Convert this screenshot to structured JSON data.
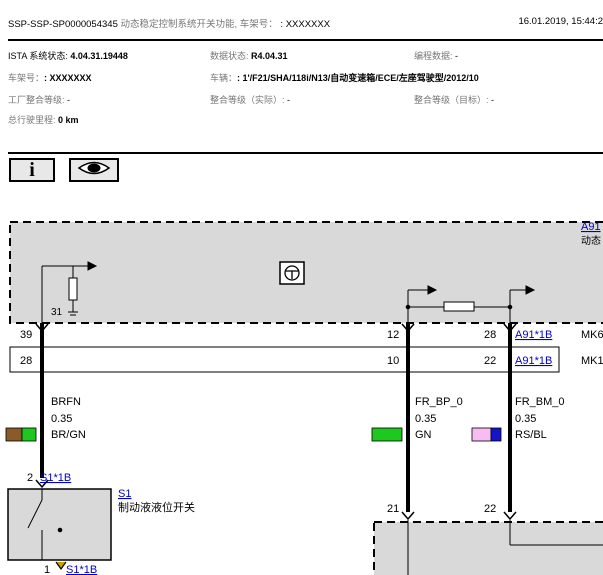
{
  "header": {
    "doc_id": "SSP-SSP-SP0000054345",
    "title": "动态稳定控制系统开关功能, 车架号：",
    "vin_value": ": XXXXXXX",
    "datetime": "16.01.2019, 15:44:2"
  },
  "info": {
    "ista_label": "ISTA 系统状态: ",
    "ista_value": "4.04.31.19448",
    "data_label": "数据状态: ",
    "data_value": "R4.04.31",
    "prog_label": "编程数据: ",
    "prog_value": "-",
    "chassis_label": "车架号：",
    "chassis_value": ": XXXXXXX",
    "vehicle_label": "车辆：",
    "vehicle_value": ": 1'/F21/SHA/118i/N13/自动变速箱/ECE/左座驾驶型/2012/10",
    "factory_label": "工厂整合等级: ",
    "factory_value": "-",
    "actual_label": "整合等级（实际）: ",
    "actual_value": "-",
    "target_label": "整合等级（目标）: ",
    "target_value": "-",
    "mileage_label": "总行驶里程: ",
    "mileage_value": "0 km"
  },
  "toolbar": {
    "info_glyph": "i"
  },
  "diagram": {
    "module_ref": "A91",
    "module_desc": "动态",
    "pin31": "31",
    "pin39": "39",
    "pin12": "12",
    "pin28_top": "28",
    "link_a91_1": "A91*1B",
    "mk_1": "MK6",
    "pin28_left": "28",
    "pin10": "10",
    "pin22": "22",
    "link_a91_2": "A91*1B",
    "mk_2": "MK1",
    "wire1_name": "BRFN",
    "wire1_size": "0.35",
    "wire1_color": "BR/GN",
    "wire2_name": "FR_BP_0",
    "wire2_size": "0.35",
    "wire2_color": "GN",
    "wire3_name": "FR_BM_0",
    "wire3_size": "0.35",
    "wire3_color": "RS/BL",
    "s1_pin2": "2",
    "s1_conn_top": "S1*1B",
    "s1_ref": "S1",
    "s1_desc": "制动液液位开关",
    "s1_pin1": "1",
    "s1_conn_bottom": "S1*1B",
    "pin21": "21",
    "pin22_bottom": "22"
  },
  "colors": {
    "brown": "#8b5a2b",
    "green": "#1ec81e",
    "pink": "#f7bdf3",
    "blue": "#1414c8",
    "grey_box": "#d9d9d9",
    "link": "#0000cc"
  }
}
